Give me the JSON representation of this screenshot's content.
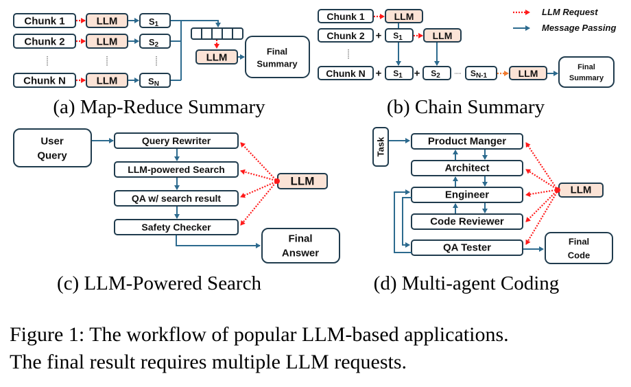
{
  "panels": {
    "a": {
      "caption": "(a) Map-Reduce Summary",
      "chunks": [
        "Chunk 1",
        "Chunk 2",
        "Chunk N"
      ],
      "llm_label": "LLM",
      "summaries": [
        {
          "base": "S",
          "sub": "1"
        },
        {
          "base": "S",
          "sub": "2"
        },
        {
          "base": "S",
          "sub": "N"
        }
      ],
      "final_line1": "Final",
      "final_line2": "Summary"
    },
    "b": {
      "caption": "(b) Chain Summary",
      "chunks": [
        "Chunk 1",
        "Chunk 2",
        "Chunk N"
      ],
      "llm_label": "LLM",
      "plus": "+",
      "s1": {
        "base": "S",
        "sub": "1"
      },
      "s2": {
        "base": "S",
        "sub": "2"
      },
      "sn1": {
        "base": "S",
        "sub": "N-1"
      },
      "final_line1": "Final",
      "final_line2": "Summary"
    },
    "c": {
      "caption": "(c) LLM-Powered Search",
      "user_query_line1": "User",
      "user_query_line2": "Query",
      "steps": [
        "Query Rewriter",
        "LLM-powered Search",
        "QA w/ search result",
        "Safety Checker"
      ],
      "llm_label": "LLM",
      "final_line1": "Final",
      "final_line2": "Answer"
    },
    "d": {
      "caption": "(d) Multi-agent Coding",
      "task": "Task",
      "agents": [
        "Product Manger",
        "Architect",
        "Engineer",
        "Code Reviewer",
        "QA Tester"
      ],
      "llm_label": "LLM",
      "final_line1": "Final",
      "final_line2": "Code"
    }
  },
  "legend": {
    "llm_request": "LLM Request",
    "message_passing": "Message Passing"
  },
  "figure_caption": {
    "line1": "Figure 1: The workflow of popular LLM-based applications.",
    "line2": "The final result requires multiple LLM requests."
  },
  "colors": {
    "llm_fill": "#fbe3d6",
    "box_stroke": "#1f3b4d",
    "message_arrow": "#2c6a8e",
    "request_arrow": "#ff1a1a",
    "chain_request_arrow": "#f07a30"
  }
}
